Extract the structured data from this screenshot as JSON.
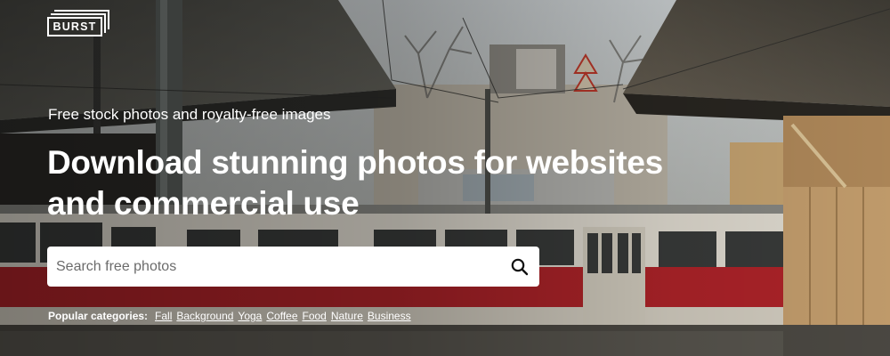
{
  "brand": {
    "logo_text": "BURST"
  },
  "hero": {
    "tagline": "Free stock photos and royalty-free images",
    "headline_line1": "Download stunning photos for websites",
    "headline_line2": "and commercial use"
  },
  "search": {
    "placeholder": "Search free photos",
    "value": "",
    "icon": "search-icon"
  },
  "categories": {
    "label": "Popular categories:",
    "items": [
      {
        "label": "Fall"
      },
      {
        "label": "Background"
      },
      {
        "label": "Yoga"
      },
      {
        "label": "Coffee"
      },
      {
        "label": "Food"
      },
      {
        "label": "Nature"
      },
      {
        "label": "Business"
      }
    ]
  },
  "colors": {
    "text": "#ffffff",
    "tram_red": "#b3242a",
    "tram_cream": "#e6e1d6",
    "wood": "#c9a270"
  }
}
